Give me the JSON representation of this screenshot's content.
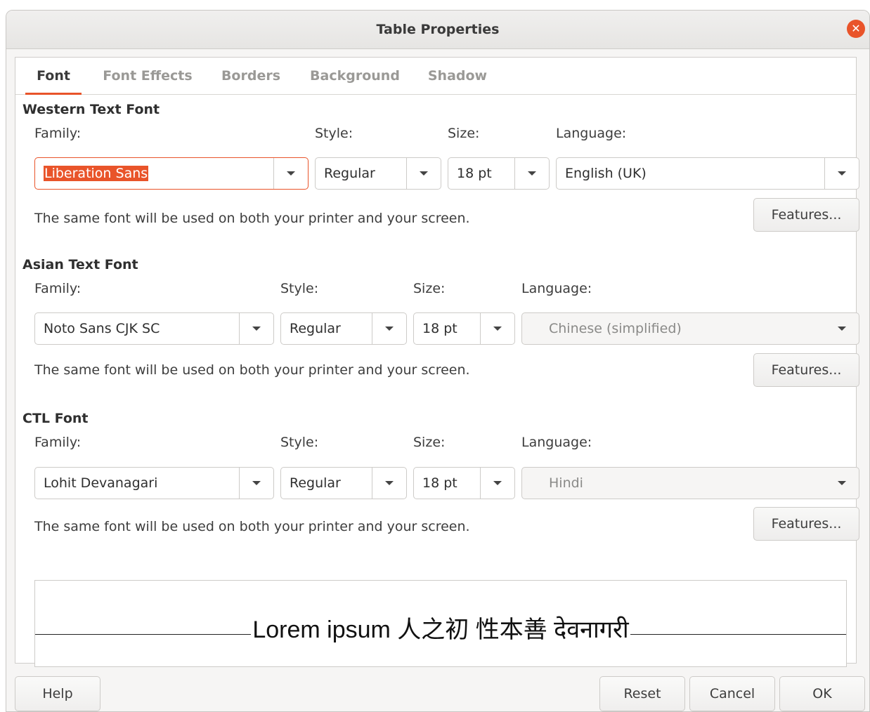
{
  "window": {
    "title": "Table Properties"
  },
  "tabs": [
    "Font",
    "Font Effects",
    "Borders",
    "Background",
    "Shadow"
  ],
  "western": {
    "title": "Western Text Font",
    "family_label": "Family:",
    "style_label": "Style:",
    "size_label": "Size:",
    "language_label": "Language:",
    "family": "Liberation Sans",
    "style": "Regular",
    "size": "18 pt",
    "language": "English (UK)",
    "info": "The same font will be used on both your printer and your screen.",
    "features": "Features..."
  },
  "asian": {
    "title": "Asian Text Font",
    "family_label": "Family:",
    "style_label": "Style:",
    "size_label": "Size:",
    "language_label": "Language:",
    "family": "Noto Sans CJK SC",
    "style": "Regular",
    "size": "18 pt",
    "language": "Chinese (simplified)",
    "info": "The same font will be used on both your printer and your screen.",
    "features": "Features..."
  },
  "ctl": {
    "title": "CTL Font",
    "family_label": "Family:",
    "style_label": "Style:",
    "size_label": "Size:",
    "language_label": "Language:",
    "family": "Lohit Devanagari",
    "style": "Regular",
    "size": "18 pt",
    "language": "Hindi",
    "info": "The same font will be used on both your printer and your screen.",
    "features": "Features..."
  },
  "preview": {
    "text": "Lorem ipsum   人之初 性本善  देवनागरी"
  },
  "buttons": {
    "help": "Help",
    "reset": "Reset",
    "cancel": "Cancel",
    "ok": "OK"
  },
  "colors": {
    "accent": "#e9542a"
  }
}
